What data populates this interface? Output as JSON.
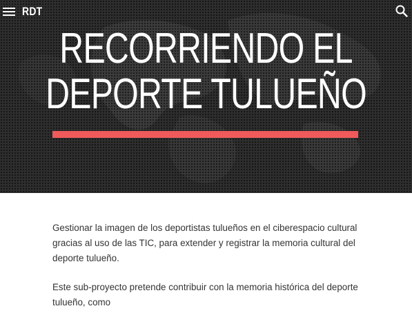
{
  "header": {
    "brand": "RDT",
    "menu_icon": "menu-icon",
    "search_icon": "search-icon"
  },
  "hero": {
    "title_line1": "RECORRIENDO EL",
    "title_line2": "DEPORTE TULUEÑO",
    "accent_color": "#f05a5a"
  },
  "content": {
    "paragraph1": "Gestionar la imagen de los deportistas tulueños en el ciberespacio cultural gracias al uso de las TIC, para extender y registrar la memoria cultural del deporte tulueño.",
    "paragraph2": "Este sub-proyecto pretende contribuir con la memoria histórica del deporte tulueño, como"
  }
}
